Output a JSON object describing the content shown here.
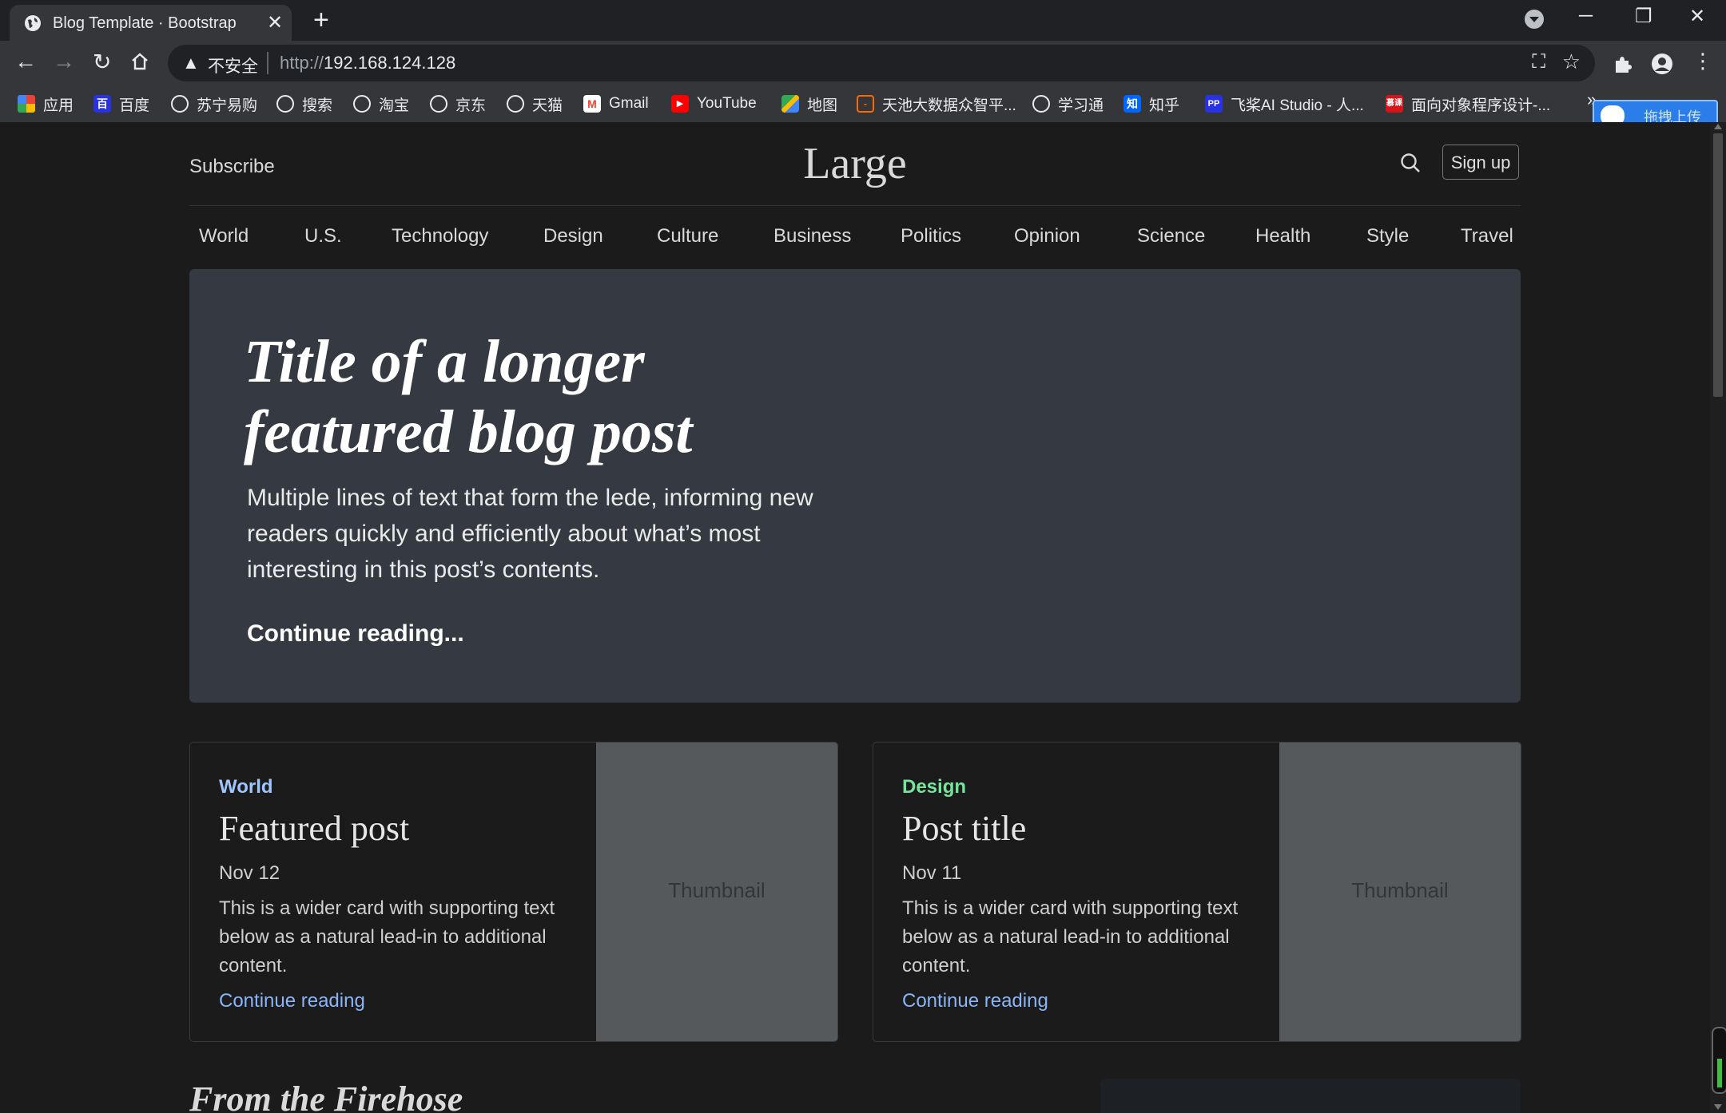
{
  "browser": {
    "tab_title": "Blog Template · Bootstrap",
    "tab_close": "✕",
    "new_tab": "+",
    "security_label": "不安全",
    "url_scheme": "http://",
    "url_host": "192.168.124.128",
    "window_controls": {
      "minimize": "─",
      "restore": "❐",
      "close": "✕"
    },
    "bookmarks": [
      {
        "label": "应用",
        "icon": "apps-grid-icon"
      },
      {
        "label": "百度",
        "icon": "baidu-icon"
      },
      {
        "label": "苏宁易购",
        "icon": "globe-icon"
      },
      {
        "label": "搜索",
        "icon": "globe-icon"
      },
      {
        "label": "淘宝",
        "icon": "globe-icon"
      },
      {
        "label": "京东",
        "icon": "globe-icon"
      },
      {
        "label": "天猫",
        "icon": "globe-icon"
      },
      {
        "label": "Gmail",
        "icon": "gmail-icon"
      },
      {
        "label": "YouTube",
        "icon": "youtube-icon"
      },
      {
        "label": "地图",
        "icon": "maps-icon"
      },
      {
        "label": "天池大数据众智平...",
        "icon": "tianchi-icon"
      },
      {
        "label": "学习通",
        "icon": "globe-icon"
      },
      {
        "label": "知乎",
        "icon": "zhihu-icon"
      },
      {
        "label": "飞桨AI Studio - 人...",
        "icon": "paddle-icon"
      },
      {
        "label": "面向对象程序设计-...",
        "icon": "course-icon"
      }
    ],
    "bookmark_overflow": "»",
    "upload_widget_label": "拖拽上传"
  },
  "site": {
    "subscribe": "Subscribe",
    "brand": "Large",
    "signup": "Sign up",
    "nav": [
      "World",
      "U.S.",
      "Technology",
      "Design",
      "Culture",
      "Business",
      "Politics",
      "Opinion",
      "Science",
      "Health",
      "Style",
      "Travel"
    ]
  },
  "hero": {
    "title_line1": "Title of a longer",
    "title_line2": "featured blog post",
    "lede": "Multiple lines of text that form the lede, informing new readers quickly and efficiently about what’s most interesting in this post’s contents.",
    "link": "Continue reading..."
  },
  "cards": [
    {
      "category": "World",
      "category_color": "#9ec5fe",
      "title": "Featured post",
      "date": "Nov 12",
      "text": "This is a wider card with supporting text below as a natural lead-in to additional content.",
      "link": "Continue reading",
      "thumb": "Thumbnail"
    },
    {
      "category": "Design",
      "category_color": "#75e59a",
      "title": "Post title",
      "date": "Nov 11",
      "text": "This is a wider card with supporting text below as a natural lead-in to additional content.",
      "link": "Continue reading",
      "thumb": "Thumbnail"
    }
  ],
  "section": {
    "firehose": "From the Firehose"
  }
}
